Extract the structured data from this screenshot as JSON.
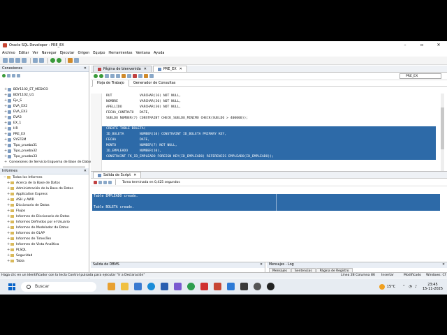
{
  "window": {
    "title": "Oracle SQL Developer : PRE_EX",
    "controls": [
      "–",
      "▫",
      "✕"
    ]
  },
  "menu": [
    "Archivo",
    "Editar",
    "Ver",
    "Navegar",
    "Ejecutar",
    "Origen",
    "Equipo",
    "Herramientas",
    "Ventana",
    "Ayuda"
  ],
  "connections": {
    "title": "Conexiones",
    "items": [
      "BDY1102_ET_MEDICO",
      "BDY1102_U1",
      "Eje_S",
      "EVA_EX2",
      "EVA_EX3",
      "EVA3",
      "EX_1",
      "HR",
      "PRE_EX",
      "SYSTEM",
      "Tipo_prueba31",
      "Tipo_prueba32",
      "Tipo_prueba33",
      "Conexiones de Servicio Esquema de Base de Datos"
    ]
  },
  "reports": {
    "title": "Informes",
    "items": [
      "Todos los Informes",
      "Acerca de la Base de Datos",
      "Administración de la Base de Datos",
      "Application Express",
      "ASH y AWR",
      "Diccionario de Datos",
      "Flujos",
      "Informes de Diccionario de Datos",
      "Informes Definidos por el Usuario",
      "Informes de Modelador de Datos",
      "Informes de OLAP",
      "Informes de TimesTen",
      "Informes de Vista Analítica",
      "PLSQL",
      "Seguridad",
      "Tabla"
    ]
  },
  "editor": {
    "tabs": [
      "Página de bienvenida",
      "PRE_EX"
    ],
    "subtabs": [
      "Hoja de Trabajo",
      "Generador de Consultas"
    ],
    "connection": "PRE_EX",
    "lines": [
      "RUT              VARCHAR(16) NOT NULL,",
      "NOMBRE           VARCHAR(30) NOT NULL,",
      "APELLIDO         VARCHAR(30) NOT NULL,",
      "FECHA_CONTRATO   DATE,",
      "SUELDO NUMBER(7) CONSTRAINT CHECK_SUELDO_MINIMO CHECK(SUELDO > 400000));",
      "",
      "CREATE TABLE BOLETA(",
      "ID_BOLETA        NUMBER(10) CONSTRAINT ID_BOLETA PRIMARY KEY,",
      "FECHA            DATE,",
      "MONTO            NUMBER(7) NOT NULL,",
      "ID_EMPLEADO      NUMBER(10),",
      "CONSTRAINT FK_ID_EMPLEADO FOREIGN KEY(ID_EMPLEADO) REFERENCES EMPLEADO(ID_EMPLEADO));"
    ],
    "selected_from": 6
  },
  "output": {
    "tab": "Salida de Script",
    "status": "Tarea terminada en 0,425 segundos",
    "lines": [
      "Table EMPLEADO creado.",
      "",
      "Table BOLETA creado."
    ]
  },
  "bottom": {
    "dbms": "Salida de DBMS",
    "log": "Mensajes - Log",
    "log_tabs": [
      "Mensajes",
      "Sentencias",
      "Página de Registro"
    ]
  },
  "status": {
    "hint": "Haga clic en un identificador con la tecla Control pulsada para ejecutar \"Ir a Declaración\"",
    "position": "Línea 28 Columna 86",
    "mode": "Insertar",
    "modified": "Modificado",
    "os": "Windows: Cf"
  },
  "taskbar": {
    "search": "Buscar",
    "temp": "15°C",
    "time": "23:45",
    "date": "15-11-2025"
  }
}
